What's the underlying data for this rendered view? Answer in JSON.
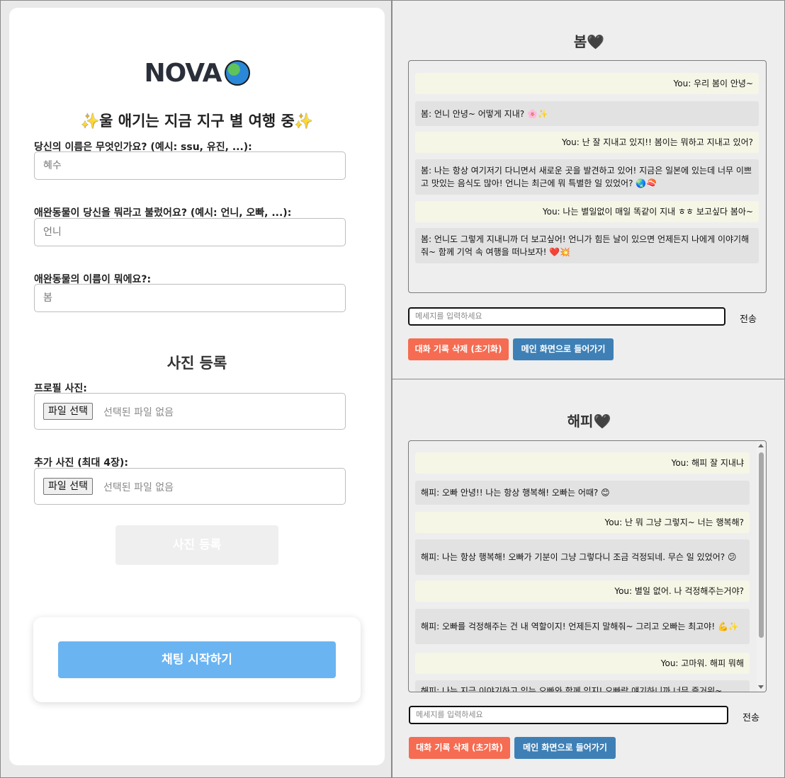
{
  "setup": {
    "logo_text": "NOVA",
    "logo_icon": "earth-globe-icon",
    "subtitle": "울 애기는 지금 지구 별 여행 중",
    "subtitle_icon": "sparkles-icon",
    "fields": [
      {
        "label": "당신의 이름은 무엇인가요? (예시: ssu, 유진, ...):",
        "value": "혜수"
      },
      {
        "label": "애완동물이 당신을 뭐라고 불렀어요? (예시: 언니, 오빠, ...):",
        "value": "언니"
      },
      {
        "label": "애완동물의 이름이 뭐에요?:",
        "value": "봄"
      }
    ],
    "photo_section_title": "사진 등록",
    "profile_photo_label": "프로필 사진:",
    "extra_photo_label": "추가 사진 (최대 4장):",
    "file_button_label": "파일 선택",
    "file_none_text": "선택된 파일 없음",
    "register_button": "사진 등록",
    "start_chat_button": "채팅 시작하기"
  },
  "chat_spring": {
    "title": "봄",
    "title_icon": "black-heart-icon",
    "messages": [
      {
        "role": "user",
        "text": "You: 우리 봄이 안녕~"
      },
      {
        "role": "bot",
        "text": "봄: 언니 안녕~ 어떻게 지내? 🌸✨"
      },
      {
        "role": "user",
        "text": "You: 난 잘 지내고 있지!! 봄이는 뭐하고 지내고 있어?"
      },
      {
        "role": "bot",
        "text": "봄: 나는 항상 여기저기 다니면서 새로운 곳을 발견하고 있어! 지금은 일본에 있는데 너무 이쁘고 맛있는 음식도 많아! 언니는 최근에 뭐 특별한 일 있었어? 🌏🍣"
      },
      {
        "role": "user",
        "text": "You: 나는 별일없이 매일 똑같이 지내 ㅎㅎ 보고싶다 봄아~"
      },
      {
        "role": "bot",
        "text": "봄: 언니도 그렇게 지내니까 더 보고싶어! 언니가 힘든 날이 있으면 언제든지 나에게 이야기해줘~ 함께 기억 속 여행을 떠나보자! ❤️💥"
      }
    ],
    "input_placeholder": "메세지를 입력하세요",
    "send_label": "전송",
    "reset_button": "대화 기록 삭제 (초기화)",
    "home_button": "메인 화면으로 들어가기"
  },
  "chat_happy": {
    "title": "해피",
    "title_icon": "black-heart-icon",
    "messages": [
      {
        "role": "user",
        "text": "You: 해피 잘 지내냐"
      },
      {
        "role": "bot",
        "text": "해피: 오빠 안녕!! 나는 항상 행복해! 오빠는 어때? 😊"
      },
      {
        "role": "user",
        "text": "You: 난 뭐 그냥 그렇지~ 너는 행복해?"
      },
      {
        "role": "bot",
        "text": "해피: 나는 항상 행복해! 오빠가 기분이 그냥 그렇다니 조금 걱정되네. 무슨 일 있었어? 😕"
      },
      {
        "role": "user",
        "text": "You: 별일 없어. 나 걱정해주는거야?"
      },
      {
        "role": "bot",
        "text": "해피: 오빠를 걱정해주는 건 내 역할이지! 언제든지 말해줘~ 그리고 오빠는 최고야! 💪✨"
      },
      {
        "role": "user",
        "text": "You: 고마워. 해피 뭐해"
      },
      {
        "role": "bot",
        "text": "해피: 나는 지금 이야기하고 있는 오빠와 함께 있지! 오빠랑 얘기하니까 너무 즐거워~"
      }
    ],
    "input_placeholder": "메세지를 입력하세요",
    "send_label": "전송",
    "reset_button": "대화 기록 삭제 (초기화)",
    "home_button": "메인 화면으로 들어가기"
  }
}
